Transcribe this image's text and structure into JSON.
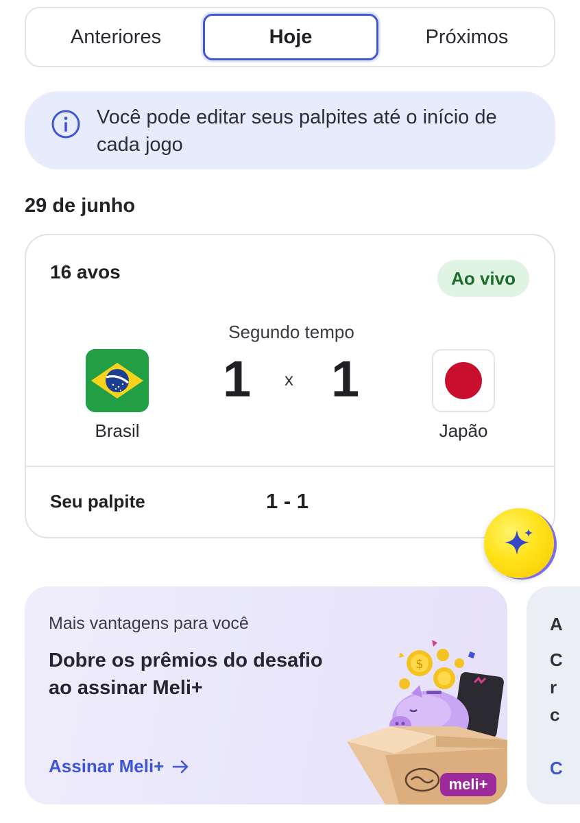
{
  "tabs": [
    {
      "label": "Anteriores"
    },
    {
      "label": "Hoje",
      "selected": true
    },
    {
      "label": "Próximos"
    }
  ],
  "info_banner": {
    "icon": "info-icon",
    "text": "Você pode editar seus palpites até o início de cada jogo"
  },
  "date_heading": "29 de junho",
  "match": {
    "round": "16 avos",
    "status": "Ao vivo",
    "period": "Segundo tempo",
    "home": {
      "name": "Brasil",
      "score": "1",
      "flag_icon": "brazil-flag-icon"
    },
    "away": {
      "name": "Japão",
      "score": "1",
      "flag_icon": "japan-flag-icon"
    },
    "separator": "x",
    "guess_label": "Seu palpite",
    "guess_value": "1 - 1"
  },
  "fab": {
    "icon": "sparkle-icon"
  },
  "promo": {
    "kicker": "Mais vantagens para você",
    "title": "Dobre os prêmios do desafio ao assinar Meli+",
    "link": "Assinar Meli+",
    "link_icon": "arrow-right-icon",
    "badge": "meli+"
  },
  "next_promo_peek": {
    "chars": [
      "A",
      "C",
      "r",
      "c",
      "C"
    ]
  },
  "colors": {
    "accent": "#3f56d4",
    "info_bg": "#e6ecfb",
    "live_bg": "#dff4e2",
    "live_text": "#1d6d2d",
    "promo_bg": "#ece9fb",
    "fab_yellow": "#ffe21a"
  }
}
